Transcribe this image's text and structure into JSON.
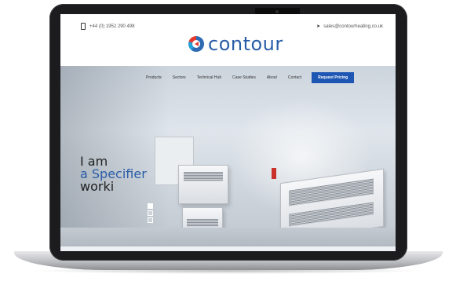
{
  "header": {
    "phone": "+44 (0) 1952 290 498",
    "email": "sales@contourheating.co.uk",
    "logo_text": "contour",
    "icons": {
      "phone": "phone-icon",
      "email": "mail-icon",
      "logo": "logo-mark-icon"
    }
  },
  "nav": {
    "items": [
      {
        "label": "Products"
      },
      {
        "label": "Sectors"
      },
      {
        "label": "Technical Hub"
      },
      {
        "label": "Case Studies"
      },
      {
        "label": "About"
      },
      {
        "label": "Contact"
      }
    ],
    "cta_label": "Request Pricing"
  },
  "hero": {
    "line1": "I am",
    "line2": "a Specifier",
    "line3": "worki"
  },
  "colors": {
    "brand_blue": "#2a5da8",
    "cta_blue": "#1d56b3",
    "accent_red": "#e63a2e"
  }
}
